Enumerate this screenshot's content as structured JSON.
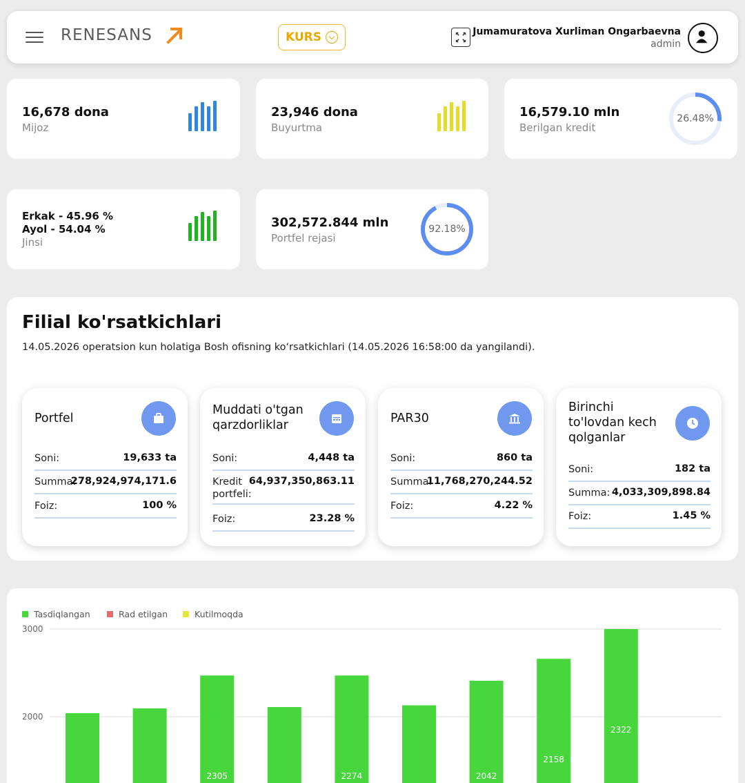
{
  "header": {
    "logo_text": "RENESANS",
    "kurs_label": "KURS",
    "user_name": "Jumamuratova Xurliman Ongarbaevna",
    "user_role": "admin"
  },
  "stats": {
    "mijoz": {
      "value": "16,678 dona",
      "label": "Mijoz",
      "color": "#2f86e0"
    },
    "buyurtma": {
      "value": "23,946 dona",
      "label": "Buyurtma",
      "color": "#e3dc2a"
    },
    "kredit": {
      "value": "16,579.10 mln",
      "label": "Berilgan kredit",
      "percent_text": "26.48%",
      "percent": 26.48
    },
    "jinsi": {
      "erkak": "Erkak - 45.96 %",
      "ayol": "Ayol - 54.04 %",
      "label": "Jinsi",
      "color": "#1fb51f"
    },
    "portfel": {
      "value": "302,572.844 mln",
      "label": "Portfel rejasi",
      "percent_text": "92.18%",
      "percent": 92.18
    }
  },
  "filial": {
    "title": "Filial ko'rsatkichlari",
    "subtitle": "14.05.2026 operatsion kun holatiga Bosh ofisning ko‘rsatkichlari (14.05.2026 16:58:00 da yangilandi).",
    "cards": [
      {
        "title": "Portfel",
        "icon": "briefcase-icon",
        "rows": [
          {
            "k": "Soni:",
            "v": "19,633 ta"
          },
          {
            "k": "Summa:",
            "v": "278,924,974,171.6"
          },
          {
            "k": "Foiz:",
            "v": "100 %"
          }
        ]
      },
      {
        "title": "Muddati o'tgan qarzdorliklar",
        "icon": "calendar-icon",
        "rows": [
          {
            "k": "Soni:",
            "v": "4,448 ta"
          },
          {
            "k": "Kredit portfeli:",
            "v": "64,937,350,863.11"
          },
          {
            "k": "Foiz:",
            "v": "23.28 %"
          }
        ]
      },
      {
        "title": "PAR30",
        "icon": "bank-icon",
        "rows": [
          {
            "k": "Soni:",
            "v": "860 ta"
          },
          {
            "k": "Summa:",
            "v": "11,768,270,244.52"
          },
          {
            "k": "Foiz:",
            "v": "4.22 %"
          }
        ]
      },
      {
        "title": "Birinchi to'lovdan kech qolganlar",
        "icon": "clock-icon",
        "rows": [
          {
            "k": "Soni:",
            "v": "182 ta"
          },
          {
            "k": "Summa:",
            "v": "4,033,309,898.84"
          },
          {
            "k": "Foiz:",
            "v": "1.45 %"
          }
        ]
      }
    ]
  },
  "chart_data": {
    "type": "bar",
    "legend": [
      {
        "name": "Tasdiqlangan",
        "color": "#47d63c"
      },
      {
        "name": "Rad etilgan",
        "color": "#e86a6a"
      },
      {
        "name": "Kutilmoqda",
        "color": "#e3e83a"
      }
    ],
    "y_ticks": [
      "3000",
      "2000"
    ],
    "ylim_visible": [
      1200,
      3000
    ],
    "series": [
      {
        "name": "Tasdiqlangan",
        "values": [
          2040,
          2095,
          2470,
          2110,
          2470,
          2130,
          2410,
          2660,
          3000
        ],
        "data_labels": [
          "",
          "",
          "2305",
          "",
          "2274",
          "",
          "2042",
          "2158",
          "2322"
        ]
      }
    ]
  }
}
